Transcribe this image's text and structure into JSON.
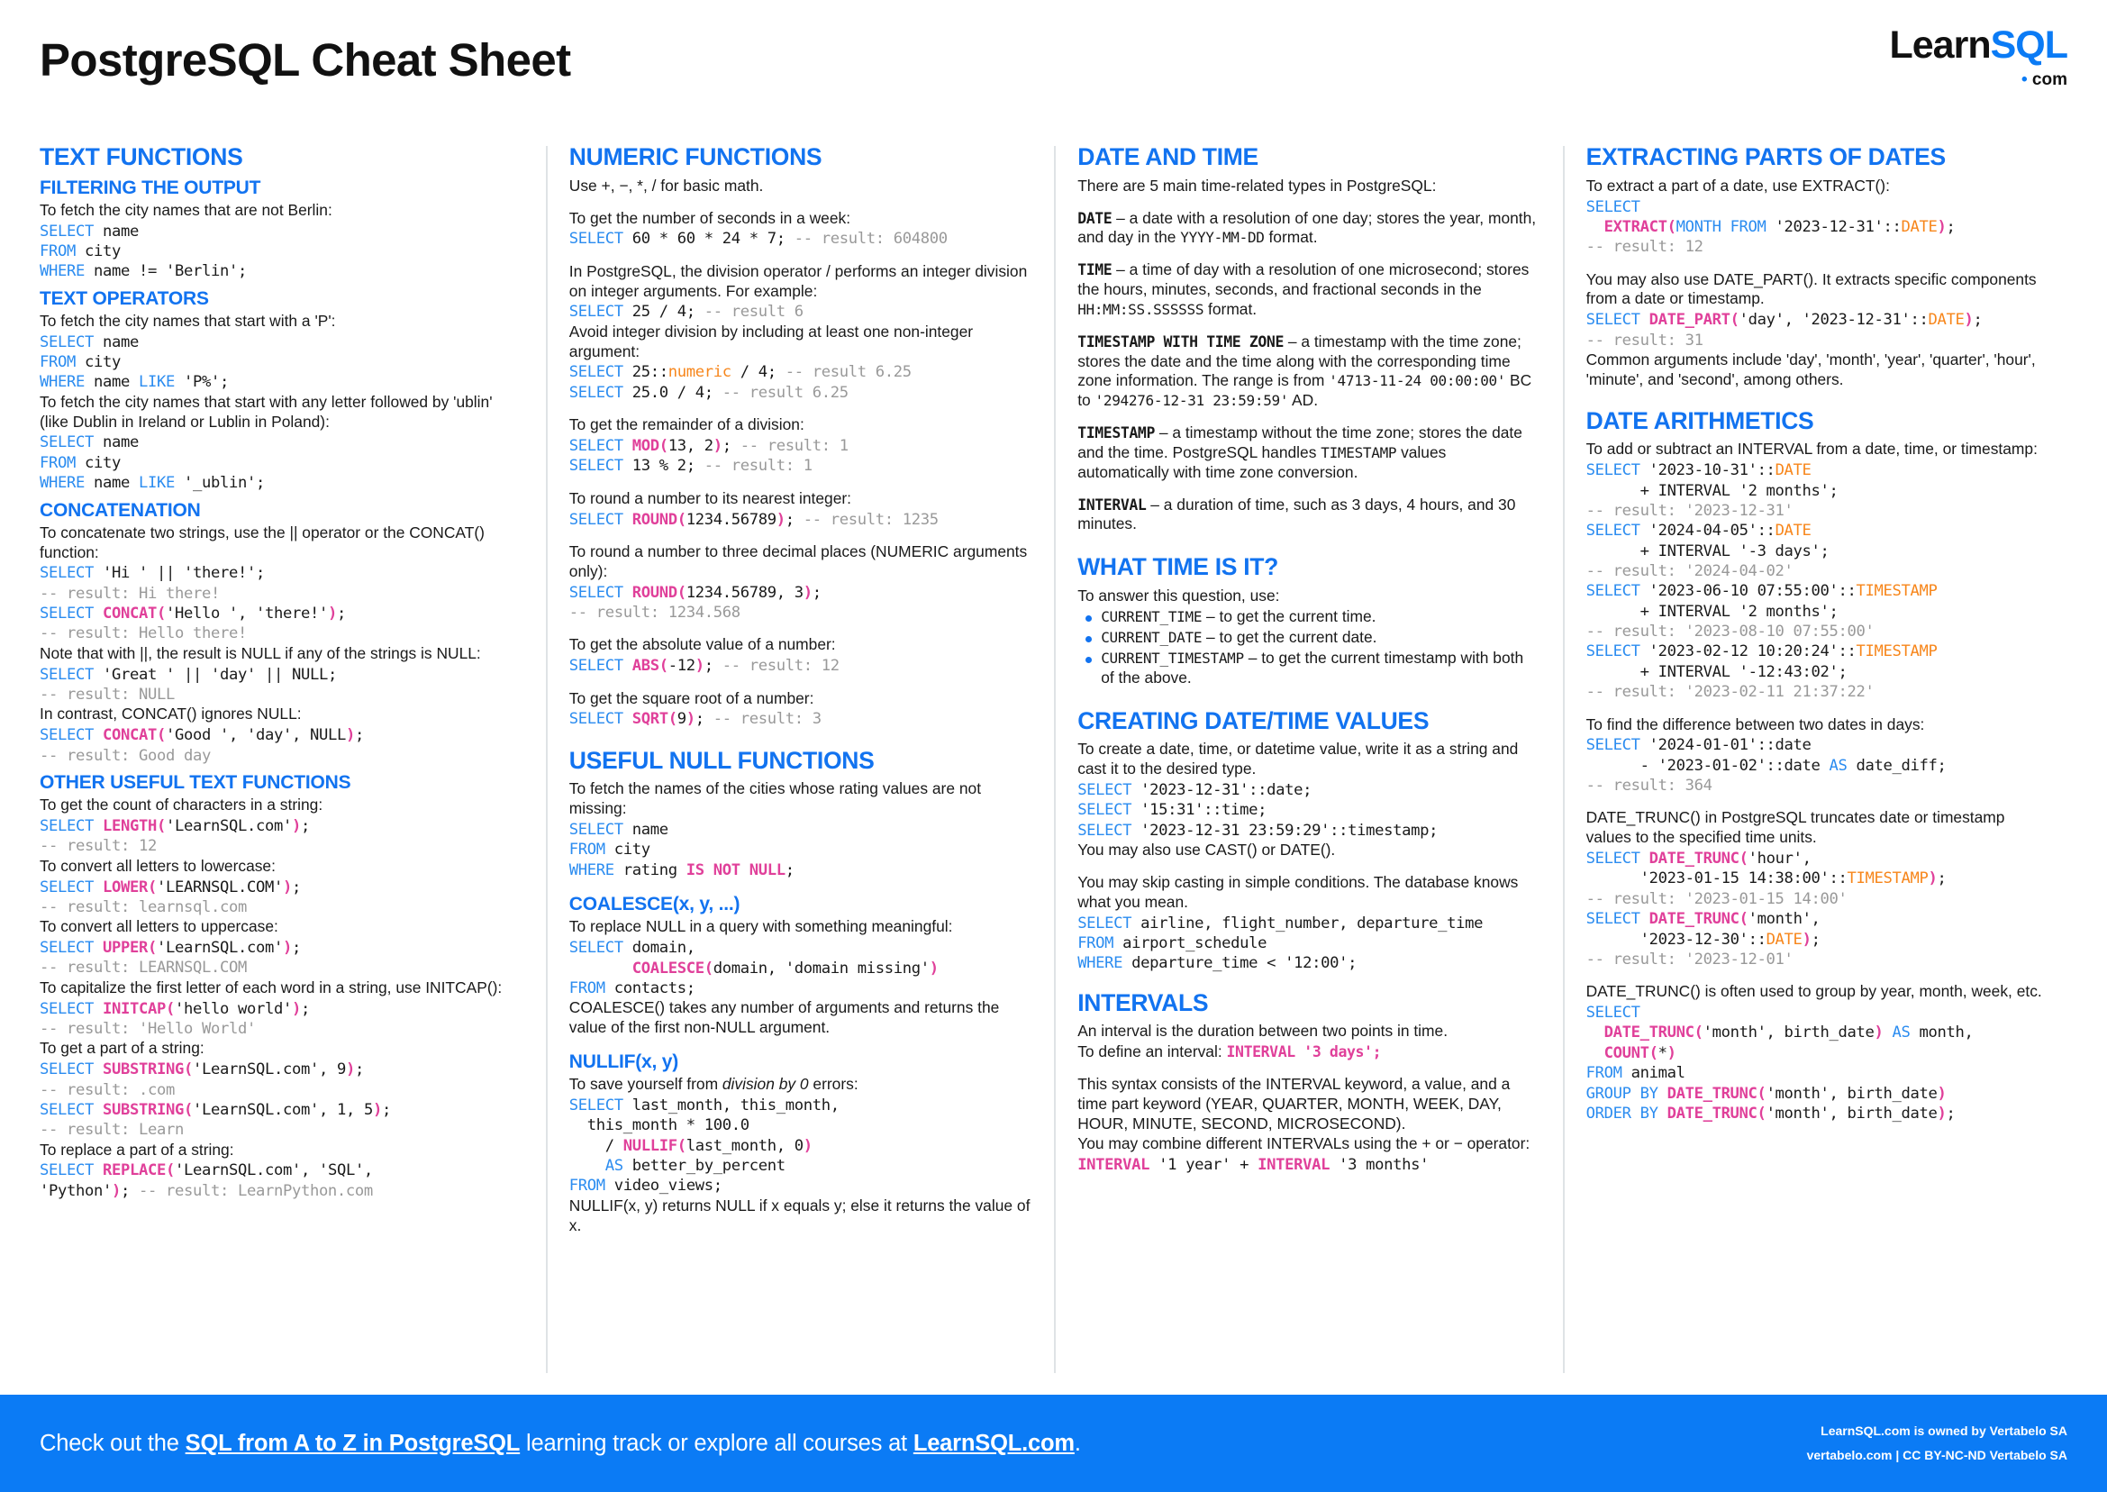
{
  "header": {
    "title": "PostgreSQL Cheat Sheet",
    "logo_learn": "Learn",
    "logo_sql": "SQL",
    "logo_dot": "•",
    "logo_com": "com"
  },
  "colors": {
    "accent_blue": "#0b7bf5",
    "heading_blue": "#1273f0",
    "keyword_blue": "#2b8cf0",
    "function_pink": "#e0409a",
    "type_orange": "#f7861b",
    "comment_gray": "#999999"
  },
  "col1": {
    "h_text_functions": "TEXT FUNCTIONS",
    "h_filtering": "FILTERING THE OUTPUT",
    "p_filter": "To fetch the city names that are not Berlin:",
    "code_filter": "SELECT name\nFROM city\nWHERE name != 'Berlin';",
    "h_text_operators": "TEXT OPERATORS",
    "p_startp": "To fetch the city names that start with a 'P':",
    "code_startp": "SELECT name\nFROM city\nWHERE name LIKE 'P%';",
    "p_ublin": "To fetch the city names that start with any letter followed by 'ublin' (like Dublin in Ireland or Lublin in Poland):",
    "code_ublin": "SELECT name\nFROM city\nWHERE name LIKE '_ublin';",
    "h_concatenation": "CONCATENATION",
    "p_concat": "To concatenate two strings, use the || operator or the CONCAT() function:",
    "code_concat1": "SELECT 'Hi ' || 'there!';",
    "res_concat1": "-- result: Hi there!",
    "code_concat2": "SELECT CONCAT('Hello ', 'there!');",
    "res_concat2": "-- result: Hello there!",
    "p_note_null": "Note that with ||, the result is NULL if any of the strings is NULL:",
    "code_null": "SELECT 'Great ' || 'day' || NULL;",
    "res_null": "-- result: NULL",
    "p_contrast": "In contrast, CONCAT() ignores NULL:",
    "code_good": "SELECT CONCAT('Good ', 'day', NULL);",
    "res_good": "-- result: Good day",
    "h_other_text": "OTHER USEFUL TEXT FUNCTIONS",
    "p_length": "To get the count of characters in a string:",
    "code_length": "SELECT LENGTH('LearnSQL.com');",
    "res_length": "-- result: 12",
    "p_lower": "To convert all letters to lowercase:",
    "code_lower": "SELECT LOWER('LEARNSQL.COM');",
    "res_lower": "-- result: learnsql.com",
    "p_upper": "To convert all letters to uppercase:",
    "code_upper": "SELECT UPPER('LearnSQL.com');",
    "res_upper": "-- result: LEARNSQL.COM",
    "p_initcap": "To capitalize the first letter of each word in a string, use INITCAP():",
    "code_initcap": "SELECT INITCAP('hello world');",
    "res_initcap": "-- result: 'Hello World'",
    "p_substring": "To get a part of a string:",
    "code_sub1": "SELECT SUBSTRING('LearnSQL.com', 9);",
    "res_sub1": "-- result: .com",
    "code_sub2": "SELECT SUBSTRING('LearnSQL.com', 1, 5);",
    "res_sub2": "-- result: Learn",
    "p_replace": "To replace a part of a string:",
    "code_replace": "SELECT REPLACE('LearnSQL.com', 'SQL', 'Python');",
    "res_replace": "-- result: LearnPython.com"
  },
  "col2": {
    "h_numeric": "NUMERIC FUNCTIONS",
    "p_basic": "Use +, −, *, / for basic math.",
    "p_seconds": "To get the number of seconds in a week:",
    "code_seconds": "SELECT 60 * 60 * 24 * 7;",
    "res_seconds": "-- result: 604800",
    "p_division": "In PostgreSQL, the division operator / performs an integer division on integer arguments. For example:",
    "code_div": "SELECT 25 / 4;",
    "res_div": "-- result 6",
    "p_avoid": "Avoid integer division by including at least one non-integer argument:",
    "code_numeric": "SELECT 25::numeric / 4;",
    "res_numeric": "-- result 6.25",
    "code_float": "SELECT 25.0 / 4;",
    "res_float": "-- result 6.25",
    "p_mod": "To get the remainder of a division:",
    "code_mod": "SELECT MOD(13, 2);",
    "res_mod": "-- result: 1",
    "code_pct": "SELECT 13 % 2;",
    "res_pct": "-- result: 1",
    "p_round": "To round a number to its nearest integer:",
    "code_round": "SELECT ROUND(1234.56789);",
    "res_round": "-- result: 1235",
    "p_round3": "To round a number to three decimal places (NUMERIC arguments only):",
    "code_round3": "SELECT ROUND(1234.56789, 3);",
    "res_round3": "-- result: 1234.568",
    "p_abs": "To get the absolute value of a number:",
    "code_abs": "SELECT ABS(-12);",
    "res_abs": "-- result: 12",
    "p_sqrt": "To get the square root of a number:",
    "code_sqrt": "SELECT SQRT(9);",
    "res_sqrt": "-- result: 3",
    "h_null": "USEFUL NULL FUNCTIONS",
    "p_notnull": "To fetch the names of the cities whose rating values are not missing:",
    "code_notnull": "SELECT name\nFROM city\nWHERE rating IS NOT NULL;",
    "h_coalesce": "COALESCE(x, y, ...)",
    "p_coalesce": "To replace NULL in a query with something meaningful:",
    "code_coalesce": "SELECT domain,\n       COALESCE(domain, 'domain missing')\nFROM contacts;",
    "p_coalesce_desc": "COALESCE() takes any number of arguments and returns the value of the first non-NULL argument.",
    "h_nullif": "NULLIF(x, y)",
    "p_nullif_pre": "To save yourself from ",
    "p_nullif_em": "division by 0",
    "p_nullif_post": " errors:",
    "code_nullif": "SELECT last_month, this_month,\n  this_month * 100.0\n    / NULLIF(last_month, 0)\n    AS better_by_percent\nFROM video_views;",
    "p_nullif_desc": "NULLIF(x, y) returns NULL if x equals y; else it returns the value of x."
  },
  "col3": {
    "h_date_time": "DATE AND TIME",
    "p_intro": "There are 5 main time-related types in PostgreSQL:",
    "t_date": "DATE",
    "p_date": " – a date with a resolution of one day; stores the year, month, and day in the ",
    "p_date_fmt": "YYYY-MM-DD",
    "p_date_end": " format.",
    "t_time": "TIME",
    "p_time": " – a time of day with a resolution of one microsecond; stores the hours, minutes, seconds, and fractional seconds in the ",
    "p_time_fmt": "HH:MM:SS.SSSSSS",
    "p_time_end": " format.",
    "t_tstz": "TIMESTAMP WITH TIME ZONE",
    "p_tstz": " – a timestamp with the time zone; stores the date and the time along with the corresponding time zone information. The range is from ",
    "p_tstz_from": "'4713-11-24 00:00:00'",
    "p_tstz_bc": " BC to ",
    "p_tstz_to": "'294276-12-31 23:59:59'",
    "p_tstz_ad": " AD.",
    "t_ts": "TIMESTAMP",
    "p_ts": " – a timestamp without the time zone; stores the date and the time. PostgreSQL handles ",
    "p_ts_kw": "TIMESTAMP",
    "p_ts_end": " values automatically with time zone conversion.",
    "t_interval": "INTERVAL",
    "p_interval": " – a duration of time, such as 3 days, 4 hours, and 30 minutes.",
    "h_whattime": "WHAT TIME IS IT?",
    "p_answer": "To answer this question, use:",
    "bullets": [
      {
        "code": "CURRENT_TIME",
        "text": " – to get the current time."
      },
      {
        "code": "CURRENT_DATE",
        "text": " – to get the current date."
      },
      {
        "code": "CURRENT_TIMESTAMP",
        "text": " – to get the current timestamp with both of the above."
      }
    ],
    "h_creating": "CREATING DATE/TIME VALUES",
    "p_creating": "To create a date, time, or datetime value, write it as a string and cast it to the desired type.",
    "code_create": "SELECT '2023-12-31'::date;\nSELECT '15:31'::time;\nSELECT '2023-12-31 23:59:29'::timestamp;",
    "p_cast": "You may also use CAST() or DATE().",
    "p_skip": "You may skip casting in simple conditions. The database knows what you mean.",
    "code_skip": "SELECT airline, flight_number, departure_time\nFROM airport_schedule\nWHERE departure_time < '12:00';",
    "h_intervals": "INTERVALS",
    "p_int1": "An interval is the duration between two points in time.",
    "p_int2_pre": "To define an interval: ",
    "p_int2_code": "INTERVAL '3 days';",
    "p_int3": "This syntax consists of the INTERVAL keyword, a value, and a time part keyword (YEAR, QUARTER, MONTH, WEEK, DAY, HOUR, MINUTE, SECOND, MICROSECOND).",
    "p_int4": "You may combine different INTERVALs using the + or − operator:",
    "code_int": "INTERVAL '1 year' + INTERVAL '3 months'"
  },
  "col4": {
    "h_extracting": "EXTRACTING PARTS OF DATES",
    "p_extract": "To extract a part of a date, use EXTRACT():",
    "code_extract": "SELECT\n  EXTRACT(MONTH FROM '2023-12-31'::DATE);",
    "res_extract": "-- result: 12",
    "p_datepart": "You may also use DATE_PART(). It extracts specific components from a date or timestamp.",
    "code_datepart": "SELECT DATE_PART('day', '2023-12-31'::DATE);",
    "res_datepart": "-- result: 31",
    "p_common": "Common arguments include 'day', 'month', 'year', 'quarter', 'hour', 'minute', and 'second', among others.",
    "h_arithmetics": "DATE ARITHMETICS",
    "p_addsub": "To add or subtract an INTERVAL from a date, time, or timestamp:",
    "code_a1": "SELECT '2023-10-31'::DATE\n     + INTERVAL '2 months';",
    "res_a1": "-- result: '2023-12-31'",
    "code_a2": "SELECT '2024-04-05'::DATE\n     + INTERVAL '-3 days';",
    "res_a2": "-- result: '2024-04-02'",
    "code_a3": "SELECT '2023-06-10 07:55:00'::TIMESTAMP\n     + INTERVAL '2 months';",
    "res_a3": "-- result: '2023-08-10 07:55:00'",
    "code_a4": "SELECT '2023-02-12 10:20:24'::TIMESTAMP\n     + INTERVAL '-12:43:02';",
    "res_a4": "-- result: '2023-02-11 21:37:22'",
    "p_diff": "To find the difference between two dates in days:",
    "code_diff": "SELECT '2024-01-01'::date\n     - '2023-01-02'::date AS date_diff;",
    "res_diff": "-- result: 364",
    "p_trunc": "DATE_TRUNC() in PostgreSQL truncates date or timestamp values to the specified time units.",
    "code_t1": "SELECT DATE_TRUNC('hour',\n     '2023-01-15 14:38:00'::TIMESTAMP);",
    "res_t1": "-- result: '2023-01-15 14:00'",
    "code_t2": "SELECT DATE_TRUNC('month',\n     '2023-12-30'::DATE);",
    "res_t2": "-- result: '2023-12-01'",
    "p_group": "DATE_TRUNC() is often used to group by year, month, week, etc.",
    "code_group": "SELECT\n  DATE_TRUNC('month', birth_date) AS month,\n  COUNT(*)\nFROM animal\nGROUP BY DATE_TRUNC('month', birth_date)\nORDER BY DATE_TRUNC('month', birth_date);"
  },
  "footer": {
    "pre": "Check out the ",
    "link1": "SQL from A to Z in PostgreSQL",
    "mid": " learning track or explore all courses at ",
    "link2": "LearnSQL.com",
    "post": ".",
    "right_line1": "LearnSQL.com is owned by Vertabelo SA",
    "right_line2": "vertabelo.com | CC BY-NC-ND Vertabelo SA"
  }
}
